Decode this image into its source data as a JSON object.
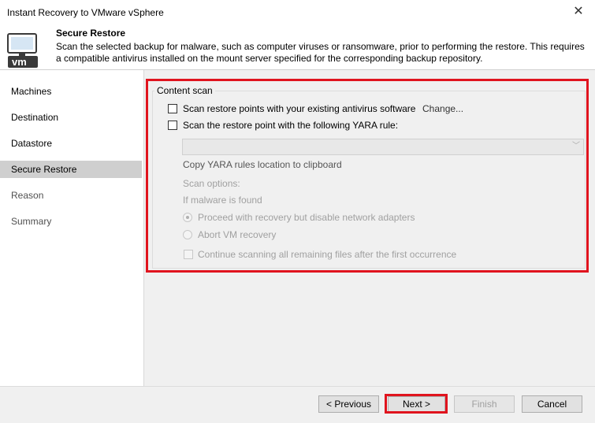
{
  "window": {
    "title": "Instant Recovery to VMware vSphere",
    "close_glyph": "✕"
  },
  "header": {
    "icon": "vm-icon",
    "icon_text": "vm",
    "title": "Secure Restore",
    "description": "Scan the selected backup for malware, such as computer viruses or ransomware, prior to performing the restore. This requires a compatible antivirus installed on the mount server specified for the corresponding backup repository."
  },
  "sidebar": {
    "items": [
      {
        "label": "Machines",
        "state": "done"
      },
      {
        "label": "Destination",
        "state": "done"
      },
      {
        "label": "Datastore",
        "state": "done"
      },
      {
        "label": "Secure Restore",
        "state": "active"
      },
      {
        "label": "Reason",
        "state": "pending"
      },
      {
        "label": "Summary",
        "state": "pending"
      }
    ]
  },
  "content_scan": {
    "group_label": "Content scan",
    "antivirus": {
      "label": "Scan restore points with your existing antivirus software",
      "checked": false,
      "change_link": "Change..."
    },
    "yara": {
      "label": "Scan the restore point with the following YARA rule:",
      "checked": false,
      "selected_value": ""
    },
    "copy_link": "Copy YARA rules location to clipboard",
    "scan_options_label": "Scan options:",
    "if_malware_label": "If malware is found",
    "options": [
      {
        "label": "Proceed with recovery but disable network adapters",
        "selected": true
      },
      {
        "label": "Abort VM recovery",
        "selected": false
      }
    ],
    "continue_scan": {
      "label": "Continue scanning all remaining files after the first occurrence",
      "checked": false
    }
  },
  "footer": {
    "previous": "< Previous",
    "next": "Next >",
    "finish": "Finish",
    "cancel": "Cancel"
  },
  "colors": {
    "highlight": "#e0141e",
    "icon_frame": "#3a3a3a",
    "icon_accent": "#5a9bd5"
  }
}
